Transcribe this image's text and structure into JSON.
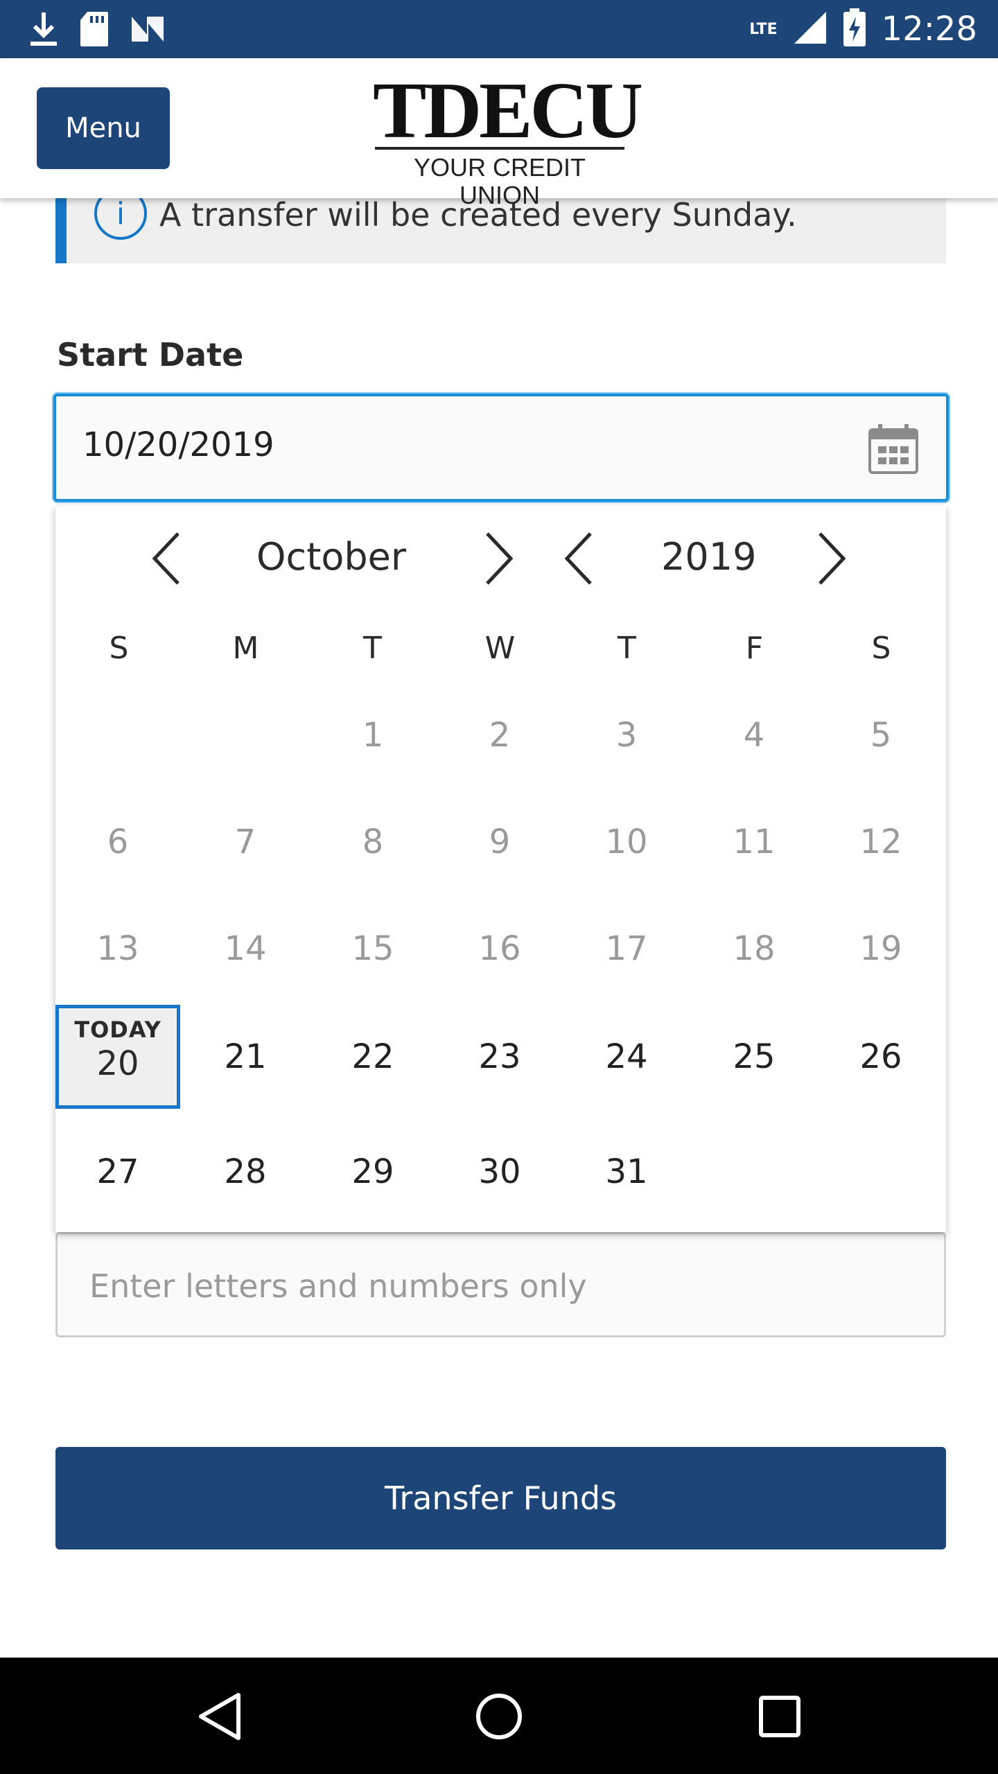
{
  "status_bar": {
    "time": "12:28",
    "network": "LTE",
    "icons": [
      "download-icon",
      "sd-card-icon",
      "n-icon",
      "signal-icon",
      "battery-charging-icon"
    ]
  },
  "header": {
    "menu_label": "Menu",
    "logo_main": "TDECU",
    "logo_sub": "YOUR CREDIT UNION"
  },
  "info_banner": {
    "text": "A transfer will be created every Sunday.",
    "icon": "info-icon"
  },
  "start_date": {
    "label": "Start Date",
    "value": "10/20/2019"
  },
  "calendar": {
    "month": "October",
    "year": "2019",
    "weekdays": [
      "S",
      "M",
      "T",
      "W",
      "T",
      "F",
      "S"
    ],
    "today_label": "TODAY",
    "today": "20",
    "weeks": [
      [
        "",
        "",
        "1",
        "2",
        "3",
        "4",
        "5"
      ],
      [
        "6",
        "7",
        "8",
        "9",
        "10",
        "11",
        "12"
      ],
      [
        "13",
        "14",
        "15",
        "16",
        "17",
        "18",
        "19"
      ],
      [
        "20",
        "21",
        "22",
        "23",
        "24",
        "25",
        "26"
      ],
      [
        "27",
        "28",
        "29",
        "30",
        "31",
        "",
        ""
      ]
    ]
  },
  "memo": {
    "placeholder": "Enter letters and numbers only"
  },
  "actions": {
    "transfer_label": "Transfer Funds"
  },
  "colors": {
    "brand": "#1d4577",
    "accent": "#1677c8",
    "focus": "#1a8fd8"
  }
}
